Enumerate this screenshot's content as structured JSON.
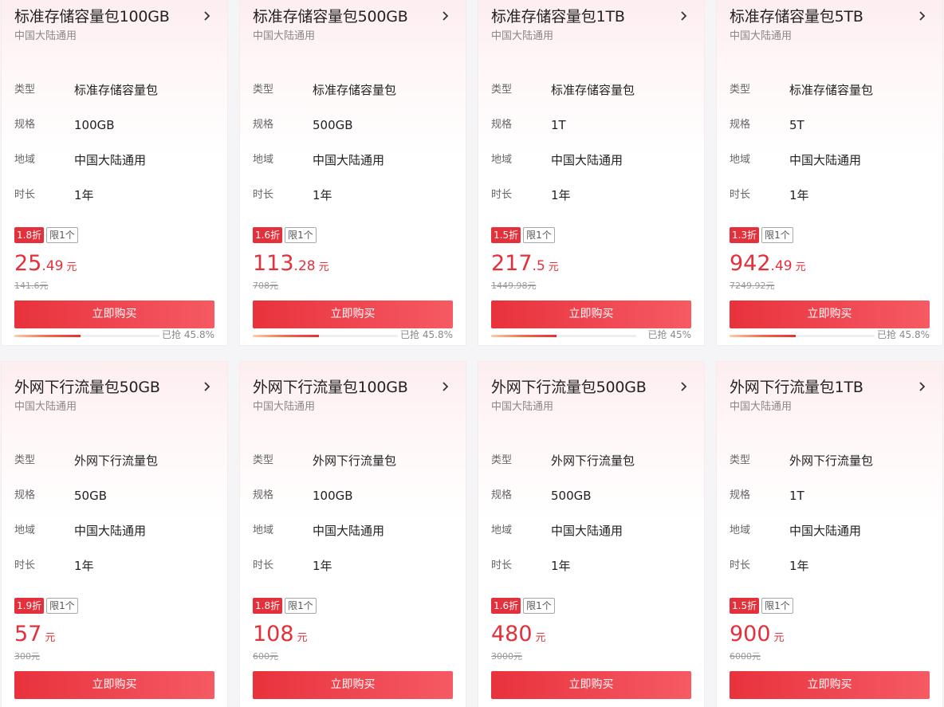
{
  "spec_labels": {
    "type": "类型",
    "spec": "规格",
    "region": "地域",
    "duration": "时长"
  },
  "buy_label": "立即购买",
  "limit_label": "限1个",
  "currency_unit": "元",
  "sold_prefix": "已抢",
  "colors": {
    "accent": "#e3303a",
    "card_bg_top": "#fdeef0"
  },
  "cards": [
    {
      "title": "标准存储容量包100GB",
      "subtitle": "中国大陆通用",
      "type": "标准存储容量包",
      "spec": "100GB",
      "region": "中国大陆通用",
      "duration": "1年",
      "discount": "1.8折",
      "price_int": "25",
      "price_dec": ".49",
      "original_price": "141.6元",
      "sold_text": "45.8%",
      "sold_pct": 45.8
    },
    {
      "title": "标准存储容量包500GB",
      "subtitle": "中国大陆通用",
      "type": "标准存储容量包",
      "spec": "500GB",
      "region": "中国大陆通用",
      "duration": "1年",
      "discount": "1.6折",
      "price_int": "113",
      "price_dec": ".28",
      "original_price": "708元",
      "sold_text": "45.8%",
      "sold_pct": 45.8
    },
    {
      "title": "标准存储容量包1TB",
      "subtitle": "中国大陆通用",
      "type": "标准存储容量包",
      "spec": "1T",
      "region": "中国大陆通用",
      "duration": "1年",
      "discount": "1.5折",
      "price_int": "217",
      "price_dec": ".5",
      "original_price": "1449.98元",
      "sold_text": "45%",
      "sold_pct": 45
    },
    {
      "title": "标准存储容量包5TB",
      "subtitle": "中国大陆通用",
      "type": "标准存储容量包",
      "spec": "5T",
      "region": "中国大陆通用",
      "duration": "1年",
      "discount": "1.3折",
      "price_int": "942",
      "price_dec": ".49",
      "original_price": "7249.92元",
      "sold_text": "45.8%",
      "sold_pct": 45.8
    },
    {
      "title": "外网下行流量包50GB",
      "subtitle": "中国大陆通用",
      "type": "外网下行流量包",
      "spec": "50GB",
      "region": "中国大陆通用",
      "duration": "1年",
      "discount": "1.9折",
      "price_int": "57",
      "price_dec": "",
      "original_price": "300元"
    },
    {
      "title": "外网下行流量包100GB",
      "subtitle": "中国大陆通用",
      "type": "外网下行流量包",
      "spec": "100GB",
      "region": "中国大陆通用",
      "duration": "1年",
      "discount": "1.8折",
      "price_int": "108",
      "price_dec": "",
      "original_price": "600元"
    },
    {
      "title": "外网下行流量包500GB",
      "subtitle": "中国大陆通用",
      "type": "外网下行流量包",
      "spec": "500GB",
      "region": "中国大陆通用",
      "duration": "1年",
      "discount": "1.6折",
      "price_int": "480",
      "price_dec": "",
      "original_price": "3000元"
    },
    {
      "title": "外网下行流量包1TB",
      "subtitle": "中国大陆通用",
      "type": "外网下行流量包",
      "spec": "1T",
      "region": "中国大陆通用",
      "duration": "1年",
      "discount": "1.5折",
      "price_int": "900",
      "price_dec": "",
      "original_price": "6000元"
    }
  ]
}
